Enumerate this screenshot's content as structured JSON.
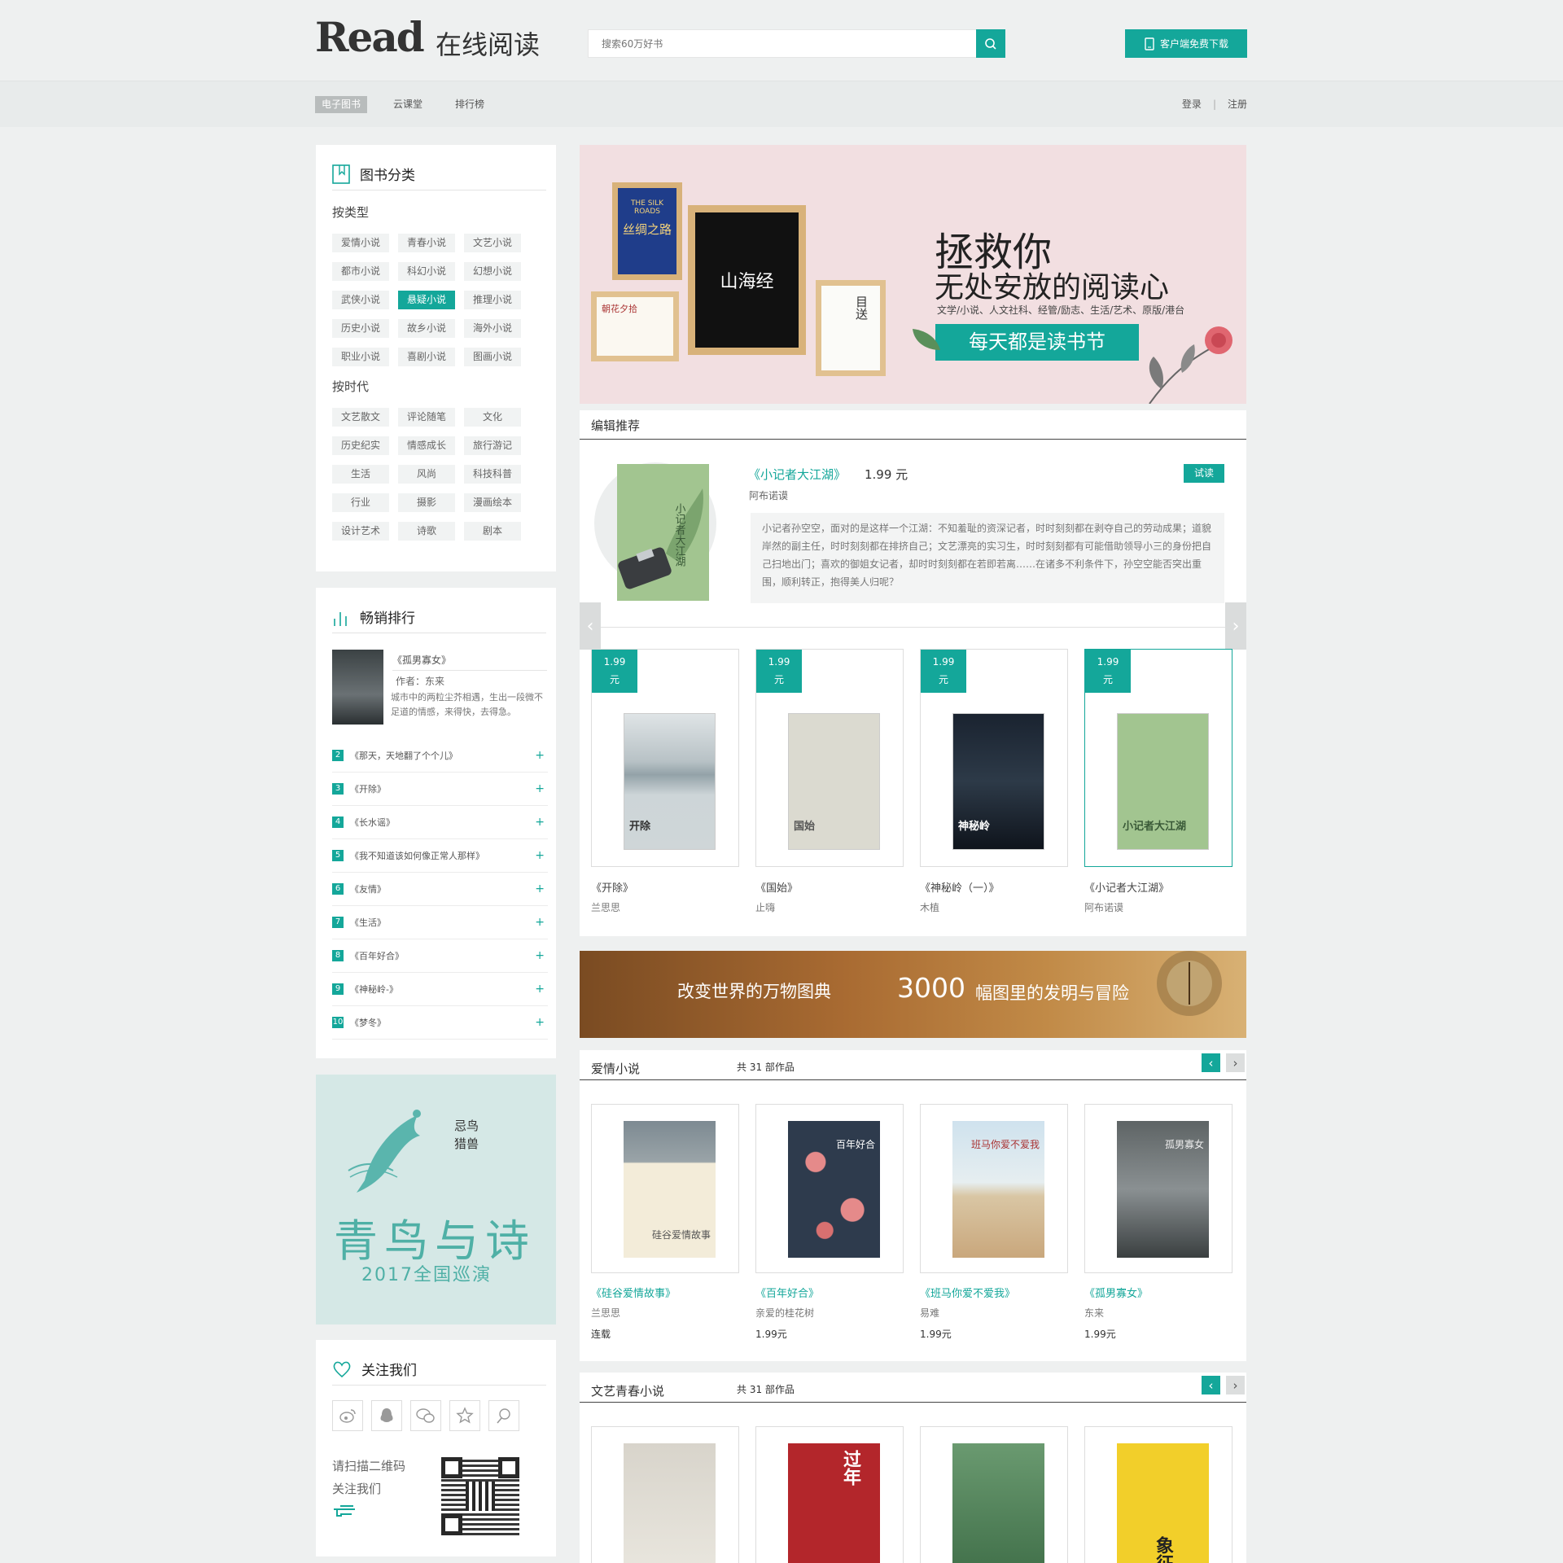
{
  "header": {
    "logo_main": "Read",
    "logo_cn": "在线阅读",
    "search_placeholder": "搜索60万好书",
    "download_label": "客户端免费下载"
  },
  "nav": {
    "items": [
      "电子图书",
      "云课堂",
      "排行榜"
    ],
    "login": "登录",
    "separator": "|",
    "register": "注册"
  },
  "categories": {
    "title": "图书分类",
    "by_type_label": "按类型",
    "by_type": [
      "爱情小说",
      "青春小说",
      "文艺小说",
      "都市小说",
      "科幻小说",
      "幻想小说",
      "武侠小说",
      "悬疑小说",
      "推理小说",
      "历史小说",
      "故乡小说",
      "海外小说",
      "职业小说",
      "喜剧小说",
      "图画小说"
    ],
    "by_era_label": "按时代",
    "by_era": [
      "文艺散文",
      "评论随笔",
      "文化",
      "历史纪实",
      "情感成长",
      "旅行游记",
      "生活",
      "风尚",
      "科技科普",
      "行业",
      "摄影",
      "漫画绘本",
      "设计艺术",
      "诗歌",
      "剧本"
    ]
  },
  "bestseller": {
    "title": "畅销排行",
    "top": {
      "title": "《孤男寡女》",
      "author": "作者：东来",
      "desc": "城市中的两粒尘芥相遇，生出一段微不足道的情感，来得快，去得急。"
    },
    "list": [
      {
        "num": "2",
        "title": "《那天，天地翻了个个儿》"
      },
      {
        "num": "3",
        "title": "《开除》"
      },
      {
        "num": "4",
        "title": "《长水谣》"
      },
      {
        "num": "5",
        "title": "《我不知道该如何像正常人那样》"
      },
      {
        "num": "6",
        "title": "《友情》"
      },
      {
        "num": "7",
        "title": "《生活》"
      },
      {
        "num": "8",
        "title": "《百年好合》"
      },
      {
        "num": "9",
        "title": "《神秘岭-》"
      },
      {
        "num": "10",
        "title": "《梦冬》"
      }
    ],
    "plus": "+"
  },
  "ad_side": {
    "calligraphy": "青鸟与诗",
    "small": "忌鸟猎兽",
    "sub": "2017全国巡演"
  },
  "follow": {
    "title": "关注我们",
    "qr_text_1": "请扫描二维码",
    "qr_text_2": "关注我们"
  },
  "banner": {
    "line1": "拯救你",
    "line2": "无处安放的阅读心",
    "line3": "文学/小说、人文社科、经管/励志、生活/艺术、原版/港台",
    "cta": "每天都是读书节",
    "book1_title": "丝绸之路",
    "book1_en": "THE SILK ROADS",
    "book2_title": "山海经",
    "book3_title": "目送",
    "book4_title": "朝花夕拾"
  },
  "editor": {
    "section_title": "编辑推荐",
    "feature_title": "《小记者大江湖》",
    "feature_price": "1.99 元",
    "feature_author": "阿布诺谟",
    "try_label": "试读",
    "feature_desc": "小记者孙空空，面对的是这样一个江湖：不知羞耻的资深记者，时时刻刻都在剥夺自己的劳动成果；道貌岸然的副主任，时时刻刻都在排挤自己；文艺漂亮的实习生，时时刻刻都有可能借助领导小三的身份把自己扫地出门；喜欢的御姐女记者，却时时刻刻都在若即若离……在诸多不利条件下，孙空空能否突出重围，顺利转正，抱得美人归呢？",
    "books": [
      {
        "price": "1.99",
        "unit": "元",
        "title": "《开除》",
        "author": "兰思思",
        "cover_text": "开除"
      },
      {
        "price": "1.99",
        "unit": "元",
        "title": "《国始》",
        "author": "止嗨",
        "cover_text": "国始"
      },
      {
        "price": "1.99",
        "unit": "元",
        "title": "《神秘岭（一）》",
        "author": "木植",
        "cover_text": "神秘岭"
      },
      {
        "price": "1.99",
        "unit": "元",
        "title": "《小记者大江湖》",
        "author": "阿布诺谟",
        "cover_text": "小记者大江湖"
      }
    ]
  },
  "promo": {
    "text1": "改变世界的万物图典",
    "num": "3000",
    "text2": "幅图里的发明与冒险"
  },
  "romance": {
    "title": "爱情小说",
    "count": "共 31 部作品",
    "books": [
      {
        "title": "《硅谷爱情故事》",
        "author": "兰思思",
        "price": "连载",
        "cover_text": "硅谷爱情故事"
      },
      {
        "title": "《百年好合》",
        "author": "亲爱的桂花树",
        "price": "1.99元",
        "cover_text": "百年好合"
      },
      {
        "title": "《班马你爱不爱我》",
        "author": "易难",
        "price": "1.99元",
        "cover_text": "班马你爱不爱我"
      },
      {
        "title": "《孤男寡女》",
        "author": "东来",
        "price": "1.99元",
        "cover_text": "孤男寡女"
      }
    ]
  },
  "youth": {
    "title": "文艺青春小说",
    "count": "共 31 部作品",
    "cover_texts": [
      "",
      "过年",
      "",
      "象征"
    ]
  },
  "colors": {
    "accent": "#14a79a"
  }
}
